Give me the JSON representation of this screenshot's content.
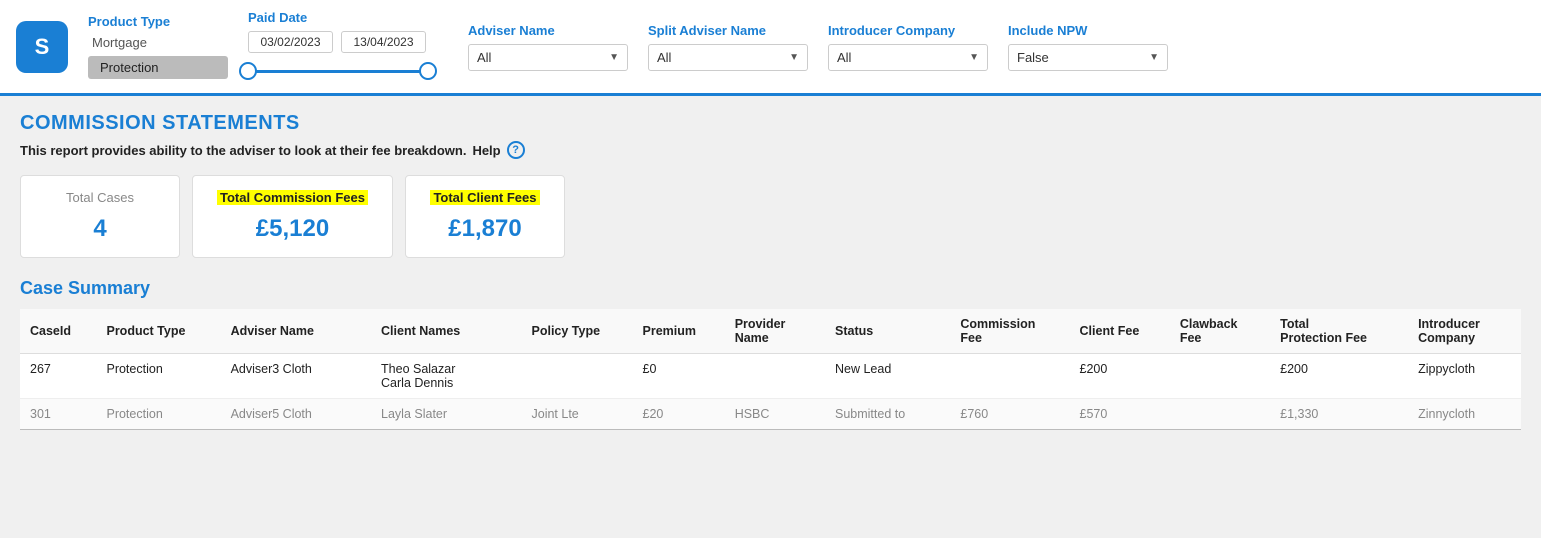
{
  "logo": {
    "text": "S",
    "aria": "Smartr365 logo"
  },
  "filters": {
    "product_type_label": "Product Type",
    "product_type_options": [
      "Mortgage",
      "Protection"
    ],
    "product_type_selected": "Protection",
    "paid_date_label": "Paid Date",
    "paid_date_from": "03/02/2023",
    "paid_date_to": "13/04/2023",
    "adviser_name_label": "Adviser Name",
    "adviser_name_value": "All",
    "split_adviser_label": "Split Adviser Name",
    "split_adviser_value": "All",
    "introducer_company_label": "Introducer Company",
    "introducer_company_value": "All",
    "include_npw_label": "Include NPW",
    "include_npw_value": "False"
  },
  "page": {
    "section_title": "COMMISSION STATEMENTS",
    "subtitle": "This report provides ability to the adviser to look at their fee breakdown.",
    "help_label": "?"
  },
  "stats": {
    "total_cases_label": "Total Cases",
    "total_cases_value": "4",
    "total_commission_label": "Total Commission Fees",
    "total_commission_value": "£5,120",
    "total_client_label": "Total Client Fees",
    "total_client_value": "£1,870"
  },
  "case_summary": {
    "title": "Case Summary",
    "columns": [
      "CaseId",
      "Product Type",
      "Adviser Name",
      "Client Names",
      "Policy Type",
      "Premium",
      "Provider Name",
      "Status",
      "Commission Fee",
      "Client Fee",
      "Clawback Fee",
      "Total Protection Fee",
      "Introducer Company"
    ],
    "rows": [
      {
        "caseid": "267",
        "product_type": "Protection",
        "adviser_name": "Adviser3 Cloth",
        "client_names": "Theo Salazar\nCarla Dennis",
        "policy_type": "",
        "premium": "£0",
        "provider_name": "",
        "status": "New Lead",
        "commission_fee": "",
        "client_fee": "£200",
        "clawback_fee": "",
        "total_protection_fee": "£200",
        "introducer_company": "Zippycloth"
      },
      {
        "caseid": "301",
        "product_type": "Protection",
        "adviser_name": "Adviser5 Cloth",
        "client_names": "Layla Slater",
        "policy_type": "Joint Lte",
        "premium": "£20",
        "provider_name": "HSBC",
        "status": "Submitted to",
        "commission_fee": "£760",
        "client_fee": "£570",
        "clawback_fee": "",
        "total_protection_fee": "£1,330",
        "introducer_company": "Zinnycloth"
      }
    ]
  }
}
